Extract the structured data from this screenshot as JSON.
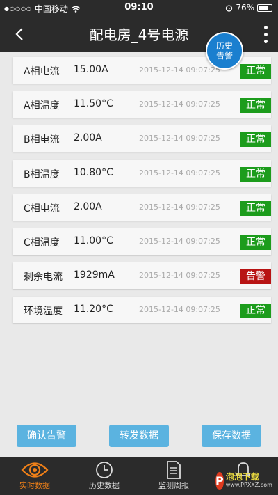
{
  "status_bar": {
    "carrier": "中国移动",
    "time": "09:10",
    "battery": "76%",
    "battery_level": 0.76
  },
  "nav": {
    "title": "配电房_4号电源",
    "history_alarm": "历史告警"
  },
  "rows": [
    {
      "name": "A相电流",
      "value": "15.00A",
      "time": "2015-12-14 09:07:25",
      "status": "正常",
      "status_color": "#1c9c1c"
    },
    {
      "name": "A相温度",
      "value": "11.50°C",
      "time": "2015-12-14 09:07:25",
      "status": "正常",
      "status_color": "#1c9c1c"
    },
    {
      "name": "B相电流",
      "value": "2.00A",
      "time": "2015-12-14 09:07:25",
      "status": "正常",
      "status_color": "#1c9c1c"
    },
    {
      "name": "B相温度",
      "value": "10.80°C",
      "time": "2015-12-14 09:07:25",
      "status": "正常",
      "status_color": "#1c9c1c"
    },
    {
      "name": "C相电流",
      "value": "2.00A",
      "time": "2015-12-14 09:07:25",
      "status": "正常",
      "status_color": "#1c9c1c"
    },
    {
      "name": "C相温度",
      "value": "11.00°C",
      "time": "2015-12-14 09:07:25",
      "status": "正常",
      "status_color": "#1c9c1c"
    },
    {
      "name": "剩余电流",
      "value": "1929mA",
      "time": "2015-12-14 09:07:25",
      "status": "告警",
      "status_color": "#b81414"
    },
    {
      "name": "环境温度",
      "value": "11.20°C",
      "time": "2015-12-14 09:07:25",
      "status": "正常",
      "status_color": "#1c9c1c"
    }
  ],
  "actions": {
    "confirm_alarm": "确认告警",
    "forward_data": "转发数据",
    "save_data": "保存数据"
  },
  "tabs": [
    {
      "label": "实时数据",
      "icon": "eye-icon",
      "active": true
    },
    {
      "label": "历史数据",
      "icon": "clock-icon",
      "active": false
    },
    {
      "label": "监测周报",
      "icon": "document-icon",
      "active": false
    },
    {
      "label": "",
      "icon": "bell-icon",
      "active": false
    }
  ],
  "watermark": {
    "text": "泡泡下载",
    "url_text": "www.PPXXZ.com"
  },
  "colors": {
    "accent": "#f08018",
    "normal": "#1c9c1c",
    "alarm": "#b81414",
    "button": "#5bb3e0"
  }
}
